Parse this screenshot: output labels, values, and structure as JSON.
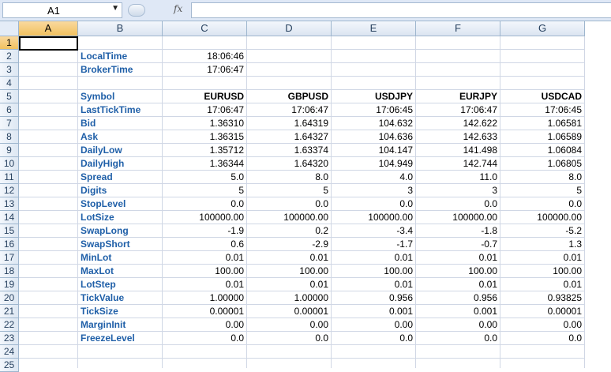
{
  "formula_bar": {
    "name_box": "A1",
    "fx_icon": "fx-icon",
    "formula": ""
  },
  "columns": [
    "A",
    "B",
    "C",
    "D",
    "E",
    "F",
    "G"
  ],
  "rows": [
    "1",
    "2",
    "3",
    "4",
    "5",
    "6",
    "7",
    "8",
    "9",
    "10",
    "11",
    "12",
    "13",
    "14",
    "15",
    "16",
    "17",
    "18",
    "19",
    "20",
    "21",
    "22",
    "23",
    "24",
    "25"
  ],
  "times": [
    {
      "label": "LocalTime",
      "value": "18:06:46"
    },
    {
      "label": "BrokerTime",
      "value": "17:06:47"
    }
  ],
  "table": {
    "header_label": "Symbol",
    "symbols": [
      "EURUSD",
      "GBPUSD",
      "USDJPY",
      "EURJPY",
      "USDCAD"
    ],
    "rows": [
      {
        "label": "LastTickTime",
        "values": [
          "17:06:47",
          "17:06:47",
          "17:06:45",
          "17:06:47",
          "17:06:45"
        ]
      },
      {
        "label": "Bid",
        "values": [
          "1.36310",
          "1.64319",
          "104.632",
          "142.622",
          "1.06581"
        ]
      },
      {
        "label": "Ask",
        "values": [
          "1.36315",
          "1.64327",
          "104.636",
          "142.633",
          "1.06589"
        ]
      },
      {
        "label": "DailyLow",
        "values": [
          "1.35712",
          "1.63374",
          "104.147",
          "141.498",
          "1.06084"
        ]
      },
      {
        "label": "DailyHigh",
        "values": [
          "1.36344",
          "1.64320",
          "104.949",
          "142.744",
          "1.06805"
        ]
      },
      {
        "label": "Spread",
        "values": [
          "5.0",
          "8.0",
          "4.0",
          "11.0",
          "8.0"
        ]
      },
      {
        "label": "Digits",
        "values": [
          "5",
          "5",
          "3",
          "3",
          "5"
        ]
      },
      {
        "label": "StopLevel",
        "values": [
          "0.0",
          "0.0",
          "0.0",
          "0.0",
          "0.0"
        ]
      },
      {
        "label": "LotSize",
        "values": [
          "100000.00",
          "100000.00",
          "100000.00",
          "100000.00",
          "100000.00"
        ]
      },
      {
        "label": "SwapLong",
        "values": [
          "-1.9",
          "0.2",
          "-3.4",
          "-1.8",
          "-5.2"
        ]
      },
      {
        "label": "SwapShort",
        "values": [
          "0.6",
          "-2.9",
          "-1.7",
          "-0.7",
          "1.3"
        ]
      },
      {
        "label": "MinLot",
        "values": [
          "0.01",
          "0.01",
          "0.01",
          "0.01",
          "0.01"
        ]
      },
      {
        "label": "MaxLot",
        "values": [
          "100.00",
          "100.00",
          "100.00",
          "100.00",
          "100.00"
        ]
      },
      {
        "label": "LotStep",
        "values": [
          "0.01",
          "0.01",
          "0.01",
          "0.01",
          "0.01"
        ]
      },
      {
        "label": "TickValue",
        "values": [
          "1.00000",
          "1.00000",
          "0.956",
          "0.956",
          "0.93825"
        ]
      },
      {
        "label": "TickSize",
        "values": [
          "0.00001",
          "0.00001",
          "0.001",
          "0.001",
          "0.00001"
        ]
      },
      {
        "label": "MarginInit",
        "values": [
          "0.00",
          "0.00",
          "0.00",
          "0.00",
          "0.00"
        ]
      },
      {
        "label": "FreezeLevel",
        "values": [
          "0.0",
          "0.0",
          "0.0",
          "0.0",
          "0.0"
        ]
      }
    ]
  }
}
